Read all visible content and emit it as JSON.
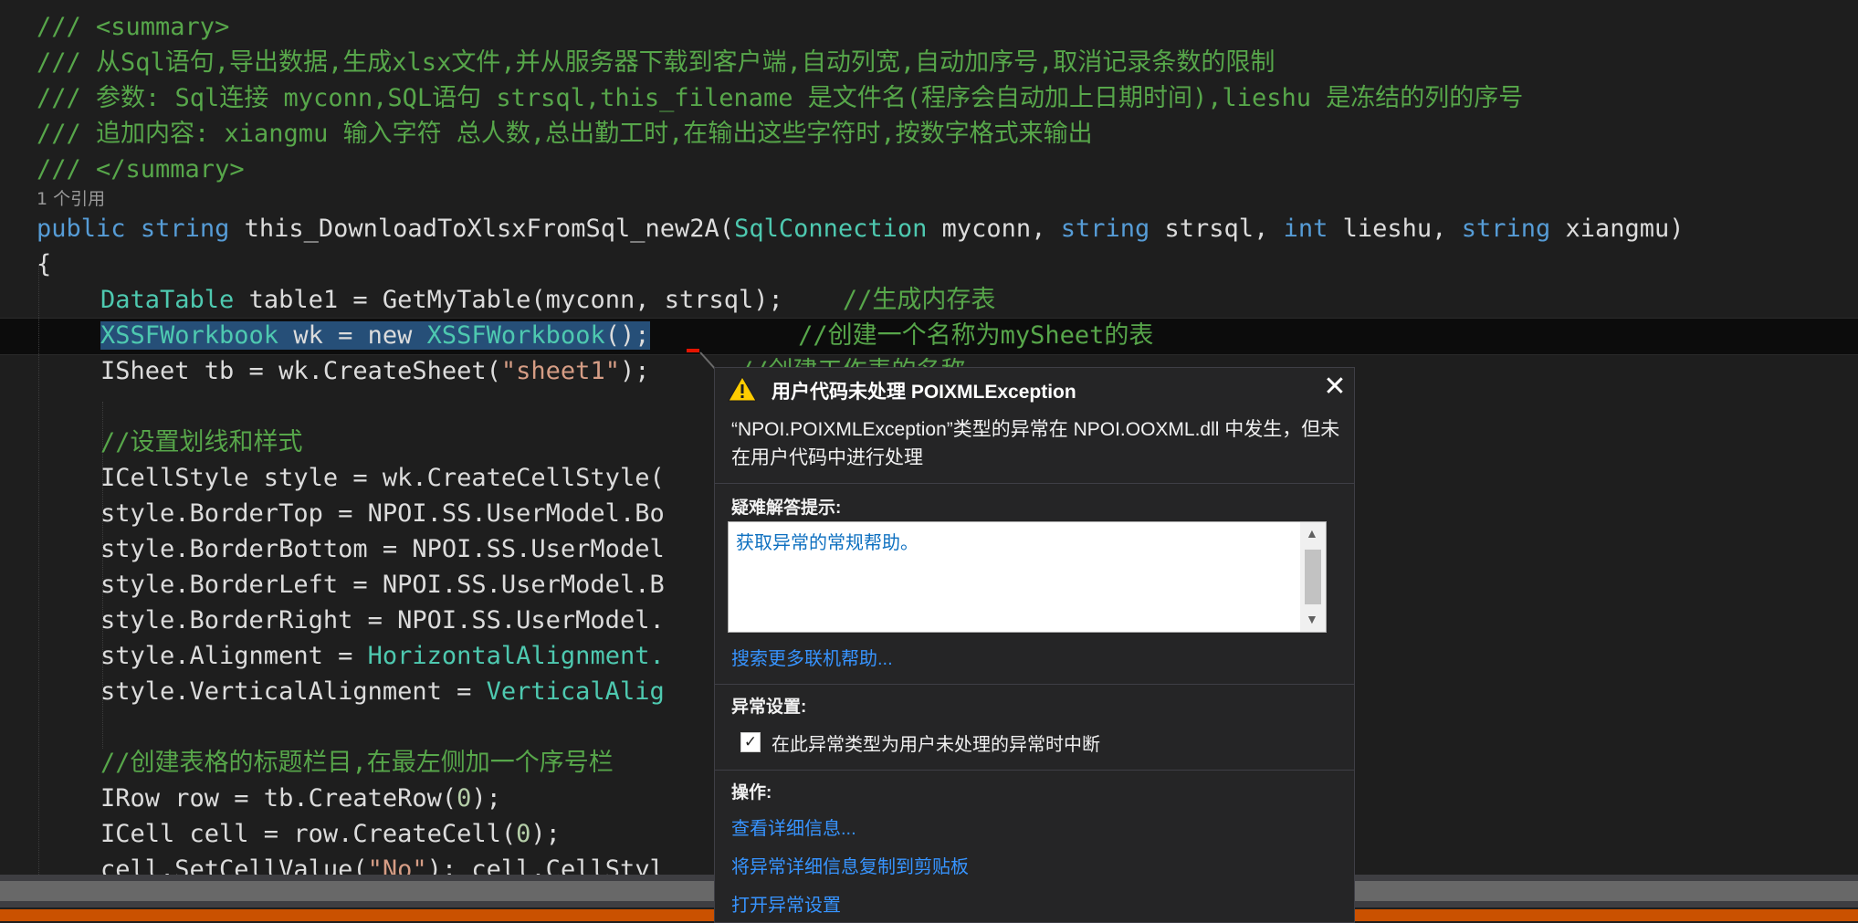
{
  "code": {
    "summary_open": "/// <summary>",
    "doc1": "/// 从Sql语句,导出数据,生成xlsx文件,并从服务器下载到客户端,自动列宽,自动加序号,取消记录条数的限制",
    "doc2": "/// 参数: Sql连接 myconn,SQL语句 strsql,this_filename 是文件名(程序会自动加上日期时间),lieshu 是冻结的列的序号",
    "doc3": "/// 追加内容: xiangmu 输入字符 总人数,总出勤工时,在输出这些字符时,按数字格式来输出",
    "summary_close": "/// </summary>",
    "ref_count": "1 个引用",
    "sig_public": "public",
    "sig_string1": "string",
    "sig_name": "this_DownloadToXlsxFromSql_new2A(",
    "sig_sqlconn": "SqlConnection",
    "sig_p1": "myconn,",
    "sig_string2": "string",
    "sig_p2": "strsql,",
    "sig_int": "int",
    "sig_p3": "lieshu,",
    "sig_string3": "string",
    "sig_p4": "xiangmu)",
    "brace": "{",
    "l1_type": "DataTable",
    "l1_rest": "table1 = GetMyTable(myconn, strsql);",
    "l1_comment": "//生成内存表",
    "l2_type1": "XSSFWorkbook",
    "l2_mid": " wk = new ",
    "l2_type2": "XSSFWorkbook",
    "l2_end": "();",
    "l2_comment": "//创建一个名称为mySheet的表",
    "l3_a": "ISheet tb = wk.CreateSheet(",
    "l3_str": "\"sheet1\"",
    "l3_b": ");",
    "l3_comment": "//创建工作表的名称",
    "l4_comment": "//设置划线和样式",
    "l5": "ICellStyle style = wk.CreateCellStyle(",
    "l6": "style.BorderTop = NPOI.SS.UserModel.Bo",
    "l7": "style.BorderBottom = NPOI.SS.UserModel",
    "l8": "style.BorderLeft = NPOI.SS.UserModel.B",
    "l9": "style.BorderRight = NPOI.SS.UserModel.",
    "l10_a": "style.Alignment = ",
    "l10_b": "HorizontalAlignment.",
    "l11_a": "style.VerticalAlignment = ",
    "l11_b": "VerticalAlig",
    "l12_comment": "//创建表格的标题栏目,在最左侧加一个序号栏",
    "l13_a": "IRow row = tb.CreateRow(",
    "l13_num": "0",
    "l13_b": ");",
    "l14_a": "ICell cell = row.CreateCell(",
    "l14_num": "0",
    "l14_b": ");",
    "l15_a": "cell.SetCellValue(",
    "l15_str": "\"No\"",
    "l15_b": "); cell.CellStyl"
  },
  "popup": {
    "title": "用户代码未处理 POIXMLException",
    "close_glyph": "✕",
    "description": "“NPOI.POIXMLException”类型的异常在 NPOI.OOXML.dll 中发生，但未在用户代码中进行处理",
    "tips_label": "疑难解答提示:",
    "tips_link": "获取异常的常规帮助。",
    "search_link": "搜索更多联机帮助...",
    "settings_label": "异常设置:",
    "break_checkbox_label": "在此异常类型为用户未处理的异常时中断",
    "break_checked": true,
    "actions_label": "操作:",
    "action_view": "查看详细信息...",
    "action_copy": "将异常详细信息复制到剪贴板",
    "action_settings": "打开异常设置"
  },
  "colors": {
    "editor_bg": "#1e1e1e",
    "comment": "#57a64a",
    "keyword": "#569cd6",
    "type": "#4ec9b0",
    "string": "#d69d85",
    "link": "#3794ff",
    "warning": "#ffcc00",
    "status_bar": "#ca5100"
  },
  "icons": {
    "warning": "warning-icon",
    "close": "close-icon",
    "checkbox": "checkbox-icon"
  }
}
